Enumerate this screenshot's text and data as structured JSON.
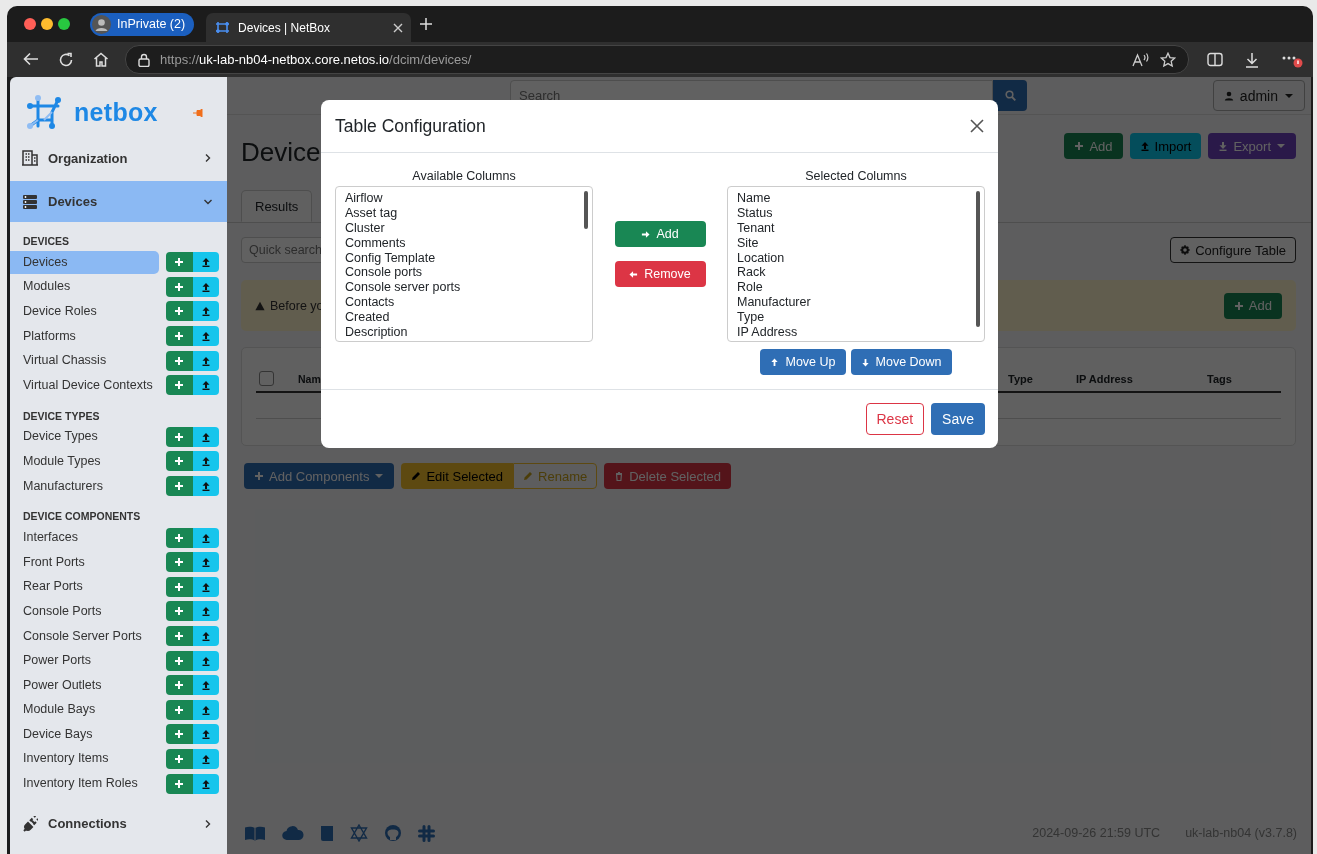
{
  "browser": {
    "profile": "InPrivate (2)",
    "tabs": [
      {
        "title": "Devices | NetBox",
        "selected": true
      }
    ],
    "url": {
      "scheme": "https://",
      "host": "uk-lab-nb04-netbox.core.netos.io",
      "path": "/dcim/devices/"
    }
  },
  "sidebar": {
    "brand": "netbox",
    "menus": [
      {
        "label": "Organization",
        "kind": "building",
        "expanded": false
      },
      {
        "label": "Devices",
        "kind": "server",
        "expanded": true,
        "groups": [
          {
            "heading": "DEVICES",
            "items": [
              {
                "label": "Devices",
                "selected": true
              },
              {
                "label": "Modules",
                "selected": false
              },
              {
                "label": "Device Roles",
                "selected": false
              },
              {
                "label": "Platforms",
                "selected": false
              },
              {
                "label": "Virtual Chassis",
                "selected": false
              },
              {
                "label": "Virtual Device Contexts",
                "selected": false
              }
            ]
          },
          {
            "heading": "DEVICE TYPES",
            "items": [
              {
                "label": "Device Types",
                "selected": false
              },
              {
                "label": "Module Types",
                "selected": false
              },
              {
                "label": "Manufacturers",
                "selected": false
              }
            ]
          },
          {
            "heading": "DEVICE COMPONENTS",
            "items": [
              {
                "label": "Interfaces",
                "selected": false
              },
              {
                "label": "Front Ports",
                "selected": false
              },
              {
                "label": "Rear Ports",
                "selected": false
              },
              {
                "label": "Console Ports",
                "selected": false
              },
              {
                "label": "Console Server Ports",
                "selected": false
              },
              {
                "label": "Power Ports",
                "selected": false
              },
              {
                "label": "Power Outlets",
                "selected": false
              },
              {
                "label": "Module Bays",
                "selected": false
              },
              {
                "label": "Device Bays",
                "selected": false
              },
              {
                "label": "Inventory Items",
                "selected": false
              },
              {
                "label": "Inventory Item Roles",
                "selected": false
              }
            ]
          }
        ]
      },
      {
        "label": "Connections",
        "kind": "plug",
        "expanded": false
      }
    ]
  },
  "main": {
    "search": {
      "placeholder": "Search"
    },
    "user": "admin",
    "title": "Device",
    "actions": [
      {
        "kind": "add",
        "label": "Add"
      },
      {
        "kind": "import",
        "label": "Import"
      },
      {
        "kind": "export",
        "label": "Export"
      }
    ],
    "tabs": [
      {
        "label": "Results",
        "selected": true
      }
    ],
    "quick_search": {
      "placeholder": "Quick search"
    },
    "configure_button": "Configure Table",
    "alert": {
      "text": "Before yo",
      "button": "Add"
    },
    "table": {
      "select_all": {
        "checked": false
      },
      "columns": [
        "Nam",
        "Type",
        "IP Address",
        "Tags"
      ]
    },
    "bulk_actions": [
      {
        "kind": "add-components",
        "label": "Add Components"
      },
      {
        "kind": "edit",
        "label": "Edit Selected"
      },
      {
        "kind": "rename",
        "label": "Rename"
      },
      {
        "kind": "delete",
        "label": "Delete Selected"
      }
    ],
    "footer": {
      "timestamp": "2024-09-26 21:59 UTC",
      "instance": "uk-lab-nb04 (v3.7.8)"
    }
  },
  "modal": {
    "title": "Table Configuration",
    "available": {
      "label": "Available Columns",
      "options": [
        "Airflow",
        "Asset tag",
        "Cluster",
        "Comments",
        "Config Template",
        "Console ports",
        "Console server ports",
        "Contacts",
        "Created",
        "Description"
      ]
    },
    "transfer_buttons": [
      {
        "kind": "add",
        "label": "Add"
      },
      {
        "kind": "remove",
        "label": "Remove"
      }
    ],
    "selected": {
      "label": "Selected Columns",
      "options": [
        "Name",
        "Status",
        "Tenant",
        "Site",
        "Location",
        "Rack",
        "Role",
        "Manufacturer",
        "Type",
        "IP Address"
      ]
    },
    "order_buttons": [
      {
        "kind": "up",
        "label": "Move Up"
      },
      {
        "kind": "down",
        "label": "Move Down"
      }
    ],
    "footer_buttons": [
      {
        "kind": "reset",
        "label": "Reset"
      },
      {
        "kind": "save",
        "label": "Save"
      }
    ]
  }
}
